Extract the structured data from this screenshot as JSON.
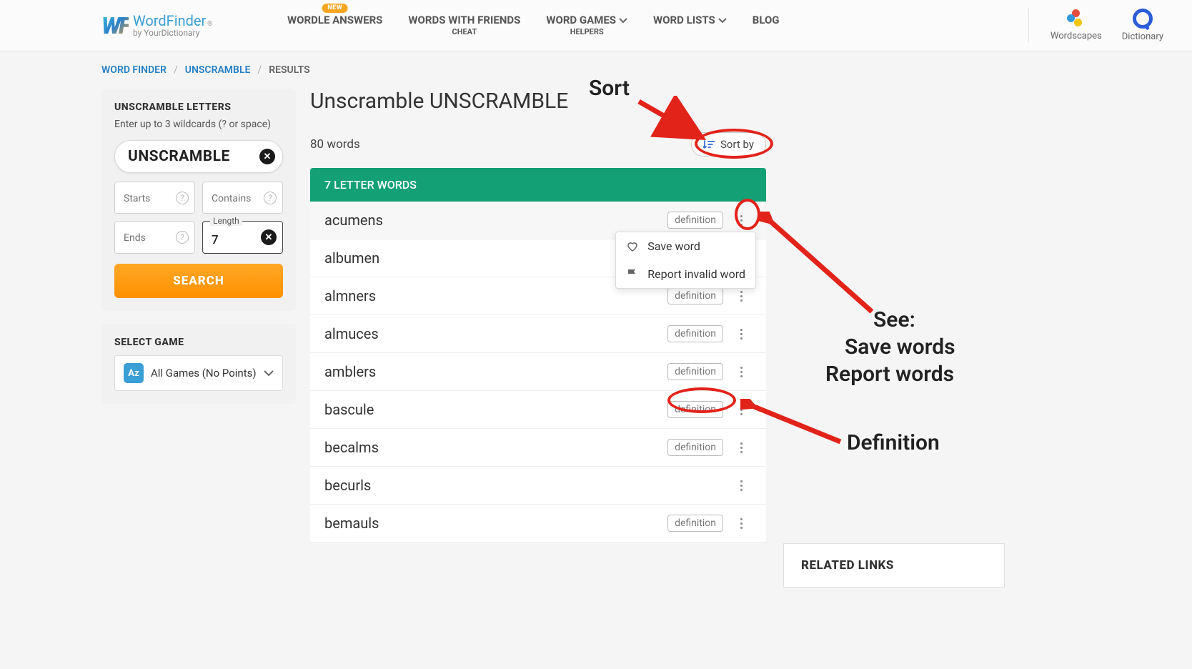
{
  "logo": {
    "brand": "WordFinder",
    "sub": "by YourDictionary"
  },
  "nav": {
    "wordle": {
      "label": "WORDLE ANSWERS",
      "badge": "NEW"
    },
    "wwf": {
      "label": "WORDS WITH FRIENDS",
      "sub": "CHEAT"
    },
    "games": {
      "label": "WORD GAMES",
      "sub": "HELPERS"
    },
    "lists": {
      "label": "WORD LISTS"
    },
    "blog": {
      "label": "BLOG"
    }
  },
  "apps": {
    "wordscapes": "Wordscapes",
    "dictionary": "Dictionary"
  },
  "breadcrumb": {
    "a": "WORD FINDER",
    "b": "UNSCRAMBLE",
    "c": "RESULTS"
  },
  "sidebar": {
    "title": "UNSCRAMBLE LETTERS",
    "hint": "Enter up to 3 wildcards (? or space)",
    "input_value": "UNSCRAMBLE",
    "starts": "Starts",
    "contains": "Contains",
    "ends": "Ends",
    "length_label": "Length",
    "length_value": "7",
    "search": "SEARCH",
    "select_game_title": "SELECT GAME",
    "game_selected": "All Games (No Points)"
  },
  "content": {
    "heading": "Unscramble UNSCRAMBLE",
    "count": "80 words",
    "sort": "Sort by",
    "category": "7 LETTER WORDS",
    "def_label": "definition",
    "words": [
      "acumens",
      "albumen",
      "almners",
      "almuces",
      "amblers",
      "bascule",
      "becalms",
      "becurls",
      "bemauls"
    ],
    "no_def_idx": [
      1,
      7
    ],
    "popup_save": "Save word",
    "popup_report": "Report invalid word"
  },
  "related": {
    "title": "RELATED LINKS"
  },
  "annotations": {
    "sort": "Sort",
    "see": "See:",
    "save_words": "Save words",
    "report_words": "Report words",
    "definition": "Definition"
  }
}
